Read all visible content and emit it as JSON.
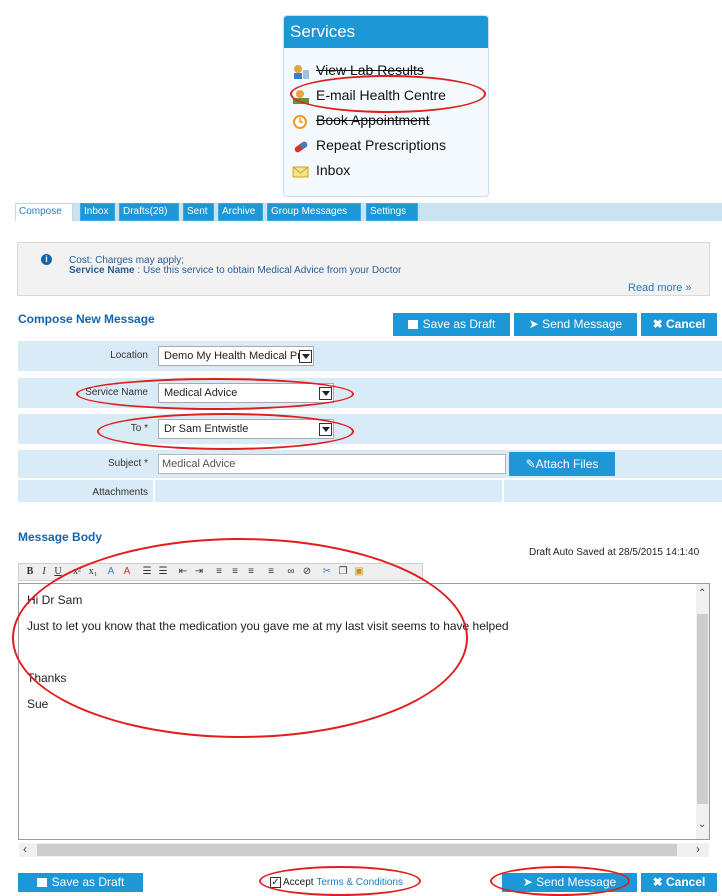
{
  "services": {
    "title": "Services",
    "items": [
      {
        "label": "View Lab Results",
        "icon": "lab-results-icon"
      },
      {
        "label": "E-mail Health Centre",
        "icon": "email-health-centre-icon"
      },
      {
        "label": "Book Appointment",
        "icon": "clock-icon"
      },
      {
        "label": "Repeat Prescriptions",
        "icon": "pill-icon"
      },
      {
        "label": "Inbox",
        "icon": "envelope-icon"
      }
    ]
  },
  "tabs": [
    "Compose",
    "Inbox",
    "Drafts(28)",
    "Sent",
    "Archive",
    "Group Messages",
    "Settings"
  ],
  "info": {
    "cost": "Cost: Charges may apply;",
    "service_label": "Service Name",
    "service_text": " : Use this service to obtain Medical Advice from your Doctor",
    "read_more": "Read more »"
  },
  "compose": {
    "title": "Compose New Message",
    "save_draft": "Save as Draft",
    "send_message": "Send Message",
    "cancel": "Cancel"
  },
  "form": {
    "location_label": "Location",
    "location_value": "Demo My Health Medical Præ",
    "service_label": "Service Name",
    "service_value": "Medical Advice",
    "to_label": "To *",
    "to_value": "Dr Sam Entwistle",
    "subject_label": "Subject *",
    "subject_value": "Medical Advice",
    "attach_files": "Attach Files",
    "attachments_label": "Attachments"
  },
  "body": {
    "title": "Message Body",
    "autosave": "Draft Auto Saved at 28/5/2015 14:1:40",
    "lines": [
      "Hi Dr Sam",
      "Just to let you know that the medication you gave me at my last visit seems to have helped",
      "Thanks",
      "Sue"
    ]
  },
  "footer": {
    "save_draft": "Save as Draft",
    "accept": "Accept",
    "terms": "Terms & Conditions",
    "send_message": "Send Message",
    "cancel": "Cancel"
  },
  "colors": {
    "accent": "#1e97d6",
    "annotation": "#e01e1e",
    "row_bg": "#d9ebf6"
  }
}
